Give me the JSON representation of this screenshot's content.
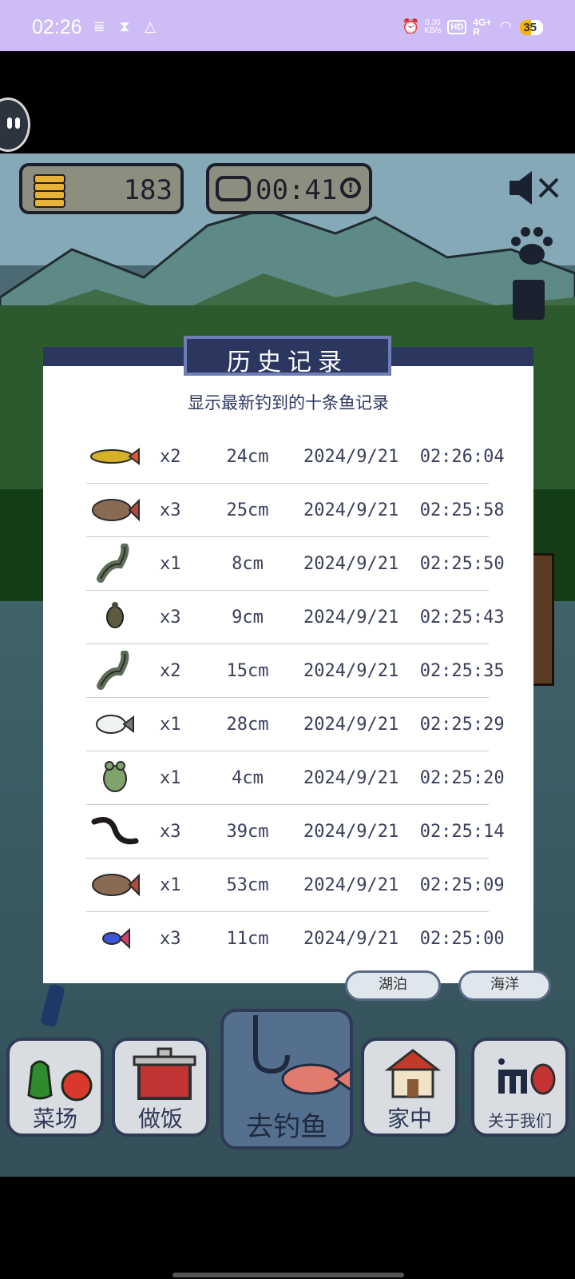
{
  "statusbar": {
    "time": "02:26",
    "net_speed_value": "0.30",
    "net_speed_unit": "KB/s",
    "hd_label": "HD",
    "r_label": "R",
    "network": "4G+",
    "battery": "35",
    "icons": [
      "database-icon",
      "hourglass-icon",
      "cloud-icon",
      "alarm-icon",
      "wifi-icon",
      "signal-icon"
    ]
  },
  "hud": {
    "coins": "183",
    "timer": "00:41"
  },
  "dialog": {
    "title": "历史记录",
    "subtitle": "显示最新钓到的十条鱼记录",
    "records": [
      {
        "icon": "arowana-icon",
        "qty": "x2",
        "length": "24cm",
        "time": "2024/9/21  02:26:04"
      },
      {
        "icon": "bass-icon",
        "qty": "x3",
        "length": "25cm",
        "time": "2024/9/21  02:25:58"
      },
      {
        "icon": "catfish-icon",
        "qty": "x1",
        "length": "8cm",
        "time": "2024/9/21  02:25:50"
      },
      {
        "icon": "turtle-icon",
        "qty": "x3",
        "length": "9cm",
        "time": "2024/9/21  02:25:43"
      },
      {
        "icon": "catfish-icon",
        "qty": "x2",
        "length": "15cm",
        "time": "2024/9/21  02:25:35"
      },
      {
        "icon": "pufferfish-icon",
        "qty": "x1",
        "length": "28cm",
        "time": "2024/9/21  02:25:29"
      },
      {
        "icon": "frog-icon",
        "qty": "x1",
        "length": "4cm",
        "time": "2024/9/21  02:25:20"
      },
      {
        "icon": "eel-icon",
        "qty": "x3",
        "length": "39cm",
        "time": "2024/9/21  02:25:14"
      },
      {
        "icon": "bass-icon",
        "qty": "x1",
        "length": "53cm",
        "time": "2024/9/21  02:25:09"
      },
      {
        "icon": "betta-icon",
        "qty": "x3",
        "length": "11cm",
        "time": "2024/9/21  02:25:00"
      }
    ]
  },
  "bubbles": {
    "lake": "湖泊",
    "ocean": "海洋"
  },
  "nav": {
    "vegetable": "菜场",
    "cook": "做饭",
    "fishing": "去钓鱼",
    "home": "家中",
    "about": "关于我们"
  },
  "colors": {
    "status_bar": "#cdbcf5",
    "dialog_header": "#2c3760",
    "hud_panel": "#8c8f7f"
  }
}
